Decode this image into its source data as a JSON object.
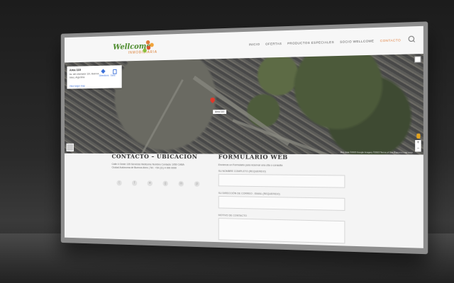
{
  "header": {
    "logo_text": "Wellcome",
    "logo_sub": "INMOBILIARIA",
    "logo_colors": [
      "#e07b39",
      "#f2a33a",
      "#d9542a",
      "#8bbf3a"
    ],
    "nav": [
      "INICIO",
      "OFERTAS",
      "PRODUCTOS ESPECIALES",
      "SOCIO WELLCOME",
      "CONTACTO"
    ],
    "active_nav": "CONTACTO",
    "accent": "#e07b39"
  },
  "map": {
    "place_name": "Area 110",
    "address": "Av. del Libertador 110, Buenos Aires, Argentina",
    "larger_map_link": "View larger map",
    "directions_label": "Directions",
    "save_label": "Save",
    "pin_label": "Area 110",
    "zoom_in": "+",
    "zoom_out": "−",
    "footer": "Map data ©2015 Google  Imagery ©2015  Terms of Use  Report a map error"
  },
  "contact": {
    "title": "CONTACTO – UBICACIÓN",
    "line1": "Calle 4 Oeste 135 Servicios Wellcome Nombre Contacto 1950 CABA",
    "line2": "Ciudad Autónoma de Buenos Aires | Tel.: +54 (11) 4 000 0000",
    "socials": [
      "twitter-icon",
      "facebook-icon",
      "twitter-bird-icon",
      "google-plus-icon",
      "linkedin-icon",
      "pinterest-icon"
    ]
  },
  "form": {
    "title": "FORMULARIO WEB",
    "intro": "Envíenos un Formulario para reservar una cita o consulta",
    "field1_label": "SU NOMBRE COMPLETO (requerido)",
    "field2_label": "SU DIRECCIÓN DE CORREO - EMAIL (requerido)",
    "field3_label": "MOTIVO DE CONTACTO"
  }
}
